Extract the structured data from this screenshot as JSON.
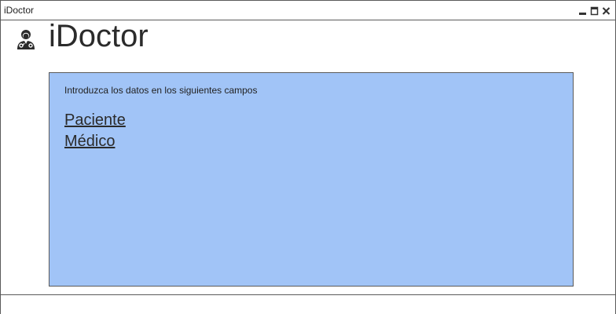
{
  "window": {
    "title": "iDoctor",
    "controls": [
      "minimize-icon",
      "maximize-icon",
      "close-icon"
    ]
  },
  "header": {
    "logo_icon": "doctor-icon",
    "title": "iDoctor"
  },
  "panel": {
    "background": "#a1c4f7",
    "instruction": "Introduzca los datos en los siguientes campos",
    "links": [
      {
        "label": "Paciente"
      },
      {
        "label": "Médico"
      }
    ]
  },
  "statusbar": {
    "text": ""
  }
}
